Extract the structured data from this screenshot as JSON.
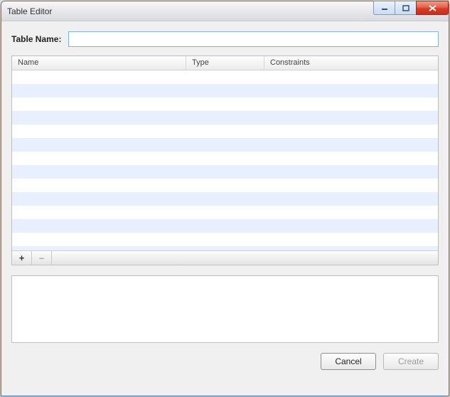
{
  "window": {
    "title": "Table Editor"
  },
  "form": {
    "table_name_label": "Table Name:",
    "table_name_value": ""
  },
  "columns_table": {
    "headers": {
      "name": "Name",
      "type": "Type",
      "constraints": "Constraints"
    },
    "rows": [],
    "empty_row_count": 14,
    "footer": {
      "add_label": "+",
      "remove_label": "–"
    }
  },
  "details_area": {
    "content": ""
  },
  "buttons": {
    "cancel": "Cancel",
    "create": "Create"
  }
}
